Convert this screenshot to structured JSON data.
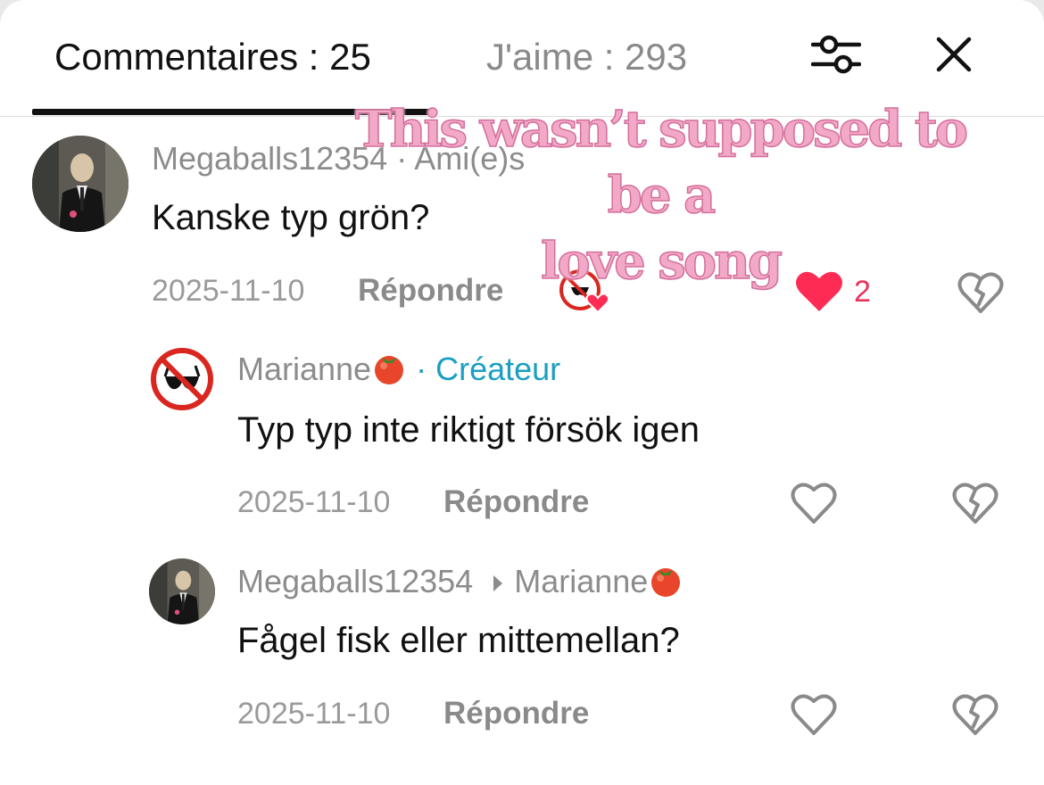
{
  "tabs": {
    "comments": "Commentaires : 25",
    "likes": "J'aime : 293"
  },
  "overlay_text": {
    "line1": "This wasn’t supposed to be a",
    "line2": "love song"
  },
  "icons": {
    "filter": "sliders-icon",
    "close": "close-icon",
    "like": "heart-icon",
    "dislike": "broken-heart-icon"
  },
  "colors": {
    "like_red": "#fe2c55",
    "creator_blue": "#1a9fc1"
  },
  "comments": [
    {
      "author": "Megaballs12354",
      "tag": "· Ami(e)s",
      "text": "Kanske typ grön?",
      "date": "2025-11-10",
      "reply_label": "Répondre",
      "likes": "2"
    },
    {
      "author": "Marianne",
      "tag": "· Créateur",
      "text": "Typ typ inte riktigt försök igen",
      "date": "2025-11-10",
      "reply_label": "Répondre"
    },
    {
      "author": "Megaballs12354",
      "reply_to": "Marianne",
      "text": "Fågel fisk eller mittemellan?",
      "date": "2025-11-10",
      "reply_label": "Répondre"
    }
  ]
}
